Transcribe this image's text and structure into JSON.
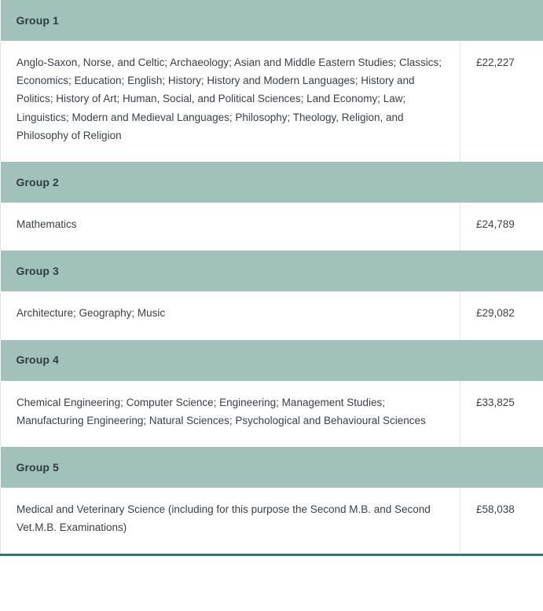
{
  "table": {
    "accent_band_color": "#a0c2ba",
    "bottom_border_color": "#29787d",
    "text_color": "#3a3f45",
    "header_text_color": "#2f3b43",
    "groups": [
      {
        "header": "Group 1",
        "subjects": "Anglo-Saxon, Norse, and Celtic; Archaeology; Asian and Middle Eastern Studies; Classics; Economics; Education; English; History; History and Modern Languages; History and Politics; History of Art; Human, Social, and Political Sciences; Land Economy; Law; Linguistics; Modern and Medieval Languages; Philosophy; Theology, Religion, and Philosophy of Religion",
        "fee": "£22,227"
      },
      {
        "header": "Group 2",
        "subjects": "Mathematics",
        "fee": "£24,789"
      },
      {
        "header": "Group 3",
        "subjects": "Architecture; Geography; Music",
        "fee": "£29,082"
      },
      {
        "header": "Group 4",
        "subjects": "Chemical Engineering; Computer Science; Engineering; Management Studies; Manufacturing Engineering; Natural Sciences; Psychological and Behavioural Sciences",
        "fee": "£33,825"
      },
      {
        "header": "Group 5",
        "subjects": "Medical and Veterinary Science (including for this purpose the Second M.B. and Second Vet.M.B. Examinations)",
        "fee": "£58,038"
      }
    ]
  }
}
